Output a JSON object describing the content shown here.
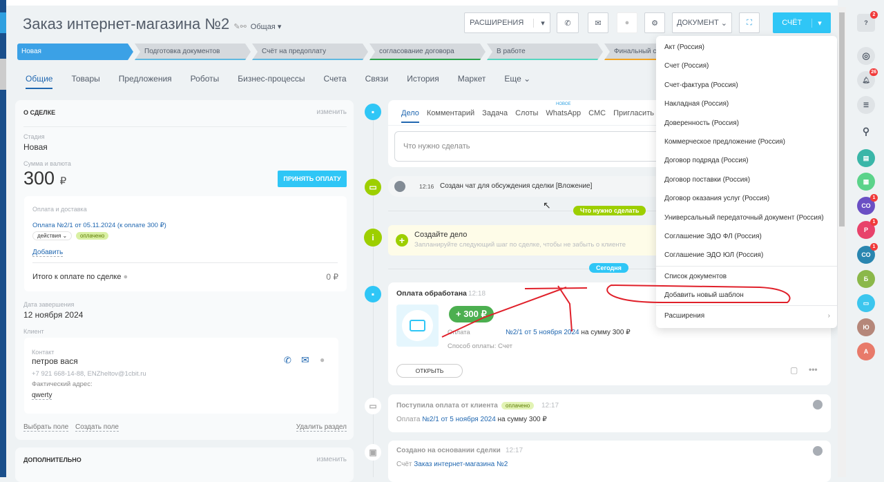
{
  "header": {
    "title": "Заказ интернет-магазина №2",
    "category": "Общая",
    "extensions_button": "РАСШИРЕНИЯ",
    "document_button": "ДОКУМЕНТ",
    "invoice_button": "СЧЁТ"
  },
  "stages": [
    "Новая",
    "Подготовка документов",
    "Счёт на предоплату",
    "согласование договора",
    "В работе",
    "Финальный счёт"
  ],
  "tabs": [
    "Общие",
    "Товары",
    "Предложения",
    "Роботы",
    "Бизнес-процессы",
    "Счета",
    "Связи",
    "История",
    "Маркет",
    "Еще"
  ],
  "about": {
    "title": "О СДЕЛКЕ",
    "edit": "изменить",
    "stage_label": "Стадия",
    "stage": "Новая",
    "sum_label": "Сумма и валюта",
    "sum": "300",
    "currency": "₽",
    "accept_payment": "ПРИНЯТЬ ОПЛАТУ",
    "payment": {
      "label": "Оплата и доставка",
      "link": "Оплата №2/1 от 05.11.2024 (к оплате 300 ₽)",
      "actions": "действия",
      "status": "оплачено",
      "add": "Добавить",
      "total_label": "Итого к оплате по сделке",
      "total": "0 ₽"
    },
    "close_date_label": "Дата завершения",
    "close_date": "12 ноября 2024",
    "client_label": "Клиент",
    "contact": {
      "label": "Контакт",
      "name": "петров вася",
      "details": "+7 921 668-14-88, ENZheltov@1cbit.ru",
      "address_label": "Фактический адрес:",
      "address": "qwerty"
    },
    "select_field": "Выбрать поле",
    "create_field": "Создать поле",
    "delete_section": "Удалить раздел"
  },
  "additional": {
    "title": "ДОПОЛНИТЕЛЬНО",
    "edit": "изменить"
  },
  "timeline": {
    "tabs": [
      "Дело",
      "Комментарий",
      "Задача",
      "Слоты",
      "WhatsApp",
      "СМС",
      "Пригласить"
    ],
    "new_badge": "новое",
    "input_placeholder": "Что нужно сделать",
    "chat_event": {
      "time": "12:16",
      "text": "Создан чат для обсуждения сделки [Вложение]"
    },
    "todo_divider": "Что нужно сделать",
    "create_task": {
      "title": "Создайте дело",
      "subtitle": "Запланируйте следующий шаг по сделке, чтобы не забыть о клиенте"
    },
    "today_divider": "Сегодня",
    "payment_processed": {
      "title": "Оплата обработана",
      "time": "12:18",
      "amount": "+ 300 ₽",
      "payment_label": "Оплата",
      "payment_link": "№2/1 от 5 ноября 2024",
      "payment_sum": "на сумму 300 ₽",
      "method": "Способ оплаты: Счет",
      "open": "ОТКРЫТЬ"
    },
    "payment_received": {
      "title": "Поступила оплата от клиента",
      "status": "оплачено",
      "time": "12:17",
      "prefix": "Оплата",
      "link": "№2/1 от 5 ноября 2024",
      "sum": "на сумму 300 ₽"
    },
    "created_from": {
      "title": "Создано на основании сделки",
      "time": "12:17",
      "prefix": "Счёт",
      "link": "Заказ интернет-магазина №2"
    }
  },
  "document_menu": {
    "items": [
      "Акт (Россия)",
      "Счет (Россия)",
      "Счет-фактура (Россия)",
      "Накладная (Россия)",
      "Доверенность (Россия)",
      "Коммерческое предложение (Россия)",
      "Договор подряда (Россия)",
      "Договор поставки (Россия)",
      "Договор оказания услуг (Россия)",
      "Универсальный передаточный документ (Россия)",
      "Соглашение ЭДО ФЛ (Россия)",
      "Соглашение ЭДО ЮЛ (Россия)"
    ],
    "list": "Список документов",
    "add_template": "Добавить новый шаблон",
    "extensions": "Расширения"
  },
  "right_bar": {
    "help_badge": "2",
    "notif_badge": "26",
    "avatars": [
      {
        "initials": "СО",
        "color": "#6a4fc4",
        "badge": "1"
      },
      {
        "initials": "Р",
        "color": "#e8436b",
        "badge": "1"
      },
      {
        "initials": "СО",
        "color": "#2a86b0",
        "badge": "1"
      },
      {
        "initials": "Б",
        "color": "#8bb84a"
      },
      {
        "initials": "Ю",
        "color": "#b5877a"
      },
      {
        "initials": "А",
        "color": "#e87a6a"
      }
    ]
  }
}
